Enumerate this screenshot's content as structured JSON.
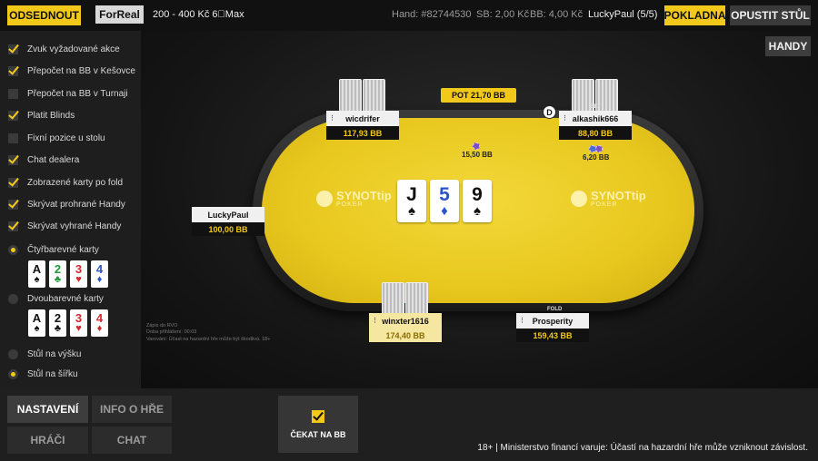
{
  "topbar": {
    "leave_label": "ODSEDNOUT",
    "mode_label": "ForReal",
    "stakes": "200 - 400 Kč 6⃣Max",
    "hand": "Hand: #82744530",
    "sb": "SB: 2,00 Kč",
    "bb": "BB: 4,00 Kč",
    "player": "LuckyPaul (5/5)",
    "cashier_label": "POKLADNA",
    "exit_label": "OPUSTIT STŮL"
  },
  "table": {
    "hands_button": "HANDY",
    "pot": "POT 21,70 BB",
    "brand_name": "SYNOTtip",
    "brand_sub": "POKER",
    "board": [
      {
        "rank": "J",
        "suit": "♠",
        "color": "#111111"
      },
      {
        "rank": "5",
        "suit": "♦",
        "color": "#2a55c8"
      },
      {
        "rank": "9",
        "suit": "♠",
        "color": "#111111"
      }
    ],
    "seats": {
      "wicdrifer": {
        "name": "wicdrifer",
        "stack": "117,93 BB"
      },
      "alkashik": {
        "name": "alkashik666",
        "stack": "88,80 BB",
        "tag": "BET"
      },
      "luckypaul": {
        "name": "LuckyPaul",
        "stack": "100,00 BB"
      },
      "winxter": {
        "name": "winxter1616",
        "stack": "174,40 BB"
      },
      "prosperity": {
        "name": "Prosperity",
        "stack": "159,43 BB",
        "tag": "FOLD"
      }
    },
    "bets": {
      "wicdrifer": "15,50 BB",
      "alkashik": "6,20 BB"
    },
    "dealer_label": "D",
    "info_lines": [
      "Zápis do RVO",
      "Doba přihlášení: 00:03",
      "Varování: Účast na hazardní hře může být škodlivá. 18+"
    ]
  },
  "sidebar": {
    "options": [
      {
        "label": "Zvuk vyžadované akce",
        "checked": true
      },
      {
        "label": "Přepočet na BB v Kešovce",
        "checked": true
      },
      {
        "label": "Přepočet na BB v Turnaji",
        "checked": false
      },
      {
        "label": "Platit Blinds",
        "checked": true
      },
      {
        "label": "Fixní pozice u stolu",
        "checked": false
      },
      {
        "label": "Chat dealera",
        "checked": true
      },
      {
        "label": "Zobrazené karty po fold",
        "checked": true
      },
      {
        "label": "Skrývat prohrané Handy",
        "checked": true
      },
      {
        "label": "Skrývat vyhrané Handy",
        "checked": true
      }
    ],
    "four_color_label": "Čtyřbarevné karty",
    "four_color_cards": [
      {
        "rank": "A",
        "suit": "♠",
        "color": "#111111"
      },
      {
        "rank": "2",
        "suit": "♣",
        "color": "#1f9a3a"
      },
      {
        "rank": "3",
        "suit": "♥",
        "color": "#d4282f"
      },
      {
        "rank": "4",
        "suit": "♦",
        "color": "#2a55c8"
      }
    ],
    "two_color_label": "Dvoubarevné karty",
    "two_color_cards": [
      {
        "rank": "A",
        "suit": "♠",
        "color": "#111111"
      },
      {
        "rank": "2",
        "suit": "♣",
        "color": "#111111"
      },
      {
        "rank": "3",
        "suit": "♥",
        "color": "#d4282f"
      },
      {
        "rank": "4",
        "suit": "♦",
        "color": "#d4282f"
      }
    ],
    "layout_vertical": "Stůl na výšku",
    "layout_horizontal": "Stůl na šířku"
  },
  "bottom": {
    "settings": "NASTAVENÍ",
    "game_info": "INFO O HŘE",
    "players": "HRÁČI",
    "chat": "CHAT",
    "wait_bb": "ČEKAT NA BB",
    "warning": "18+ | Ministerstvo financí varuje: Účastí na hazardní hře může vzniknout závislost."
  },
  "colors": {
    "accent": "#f2c91a",
    "felt": "#e8c81e",
    "background": "#1b1b1b"
  }
}
